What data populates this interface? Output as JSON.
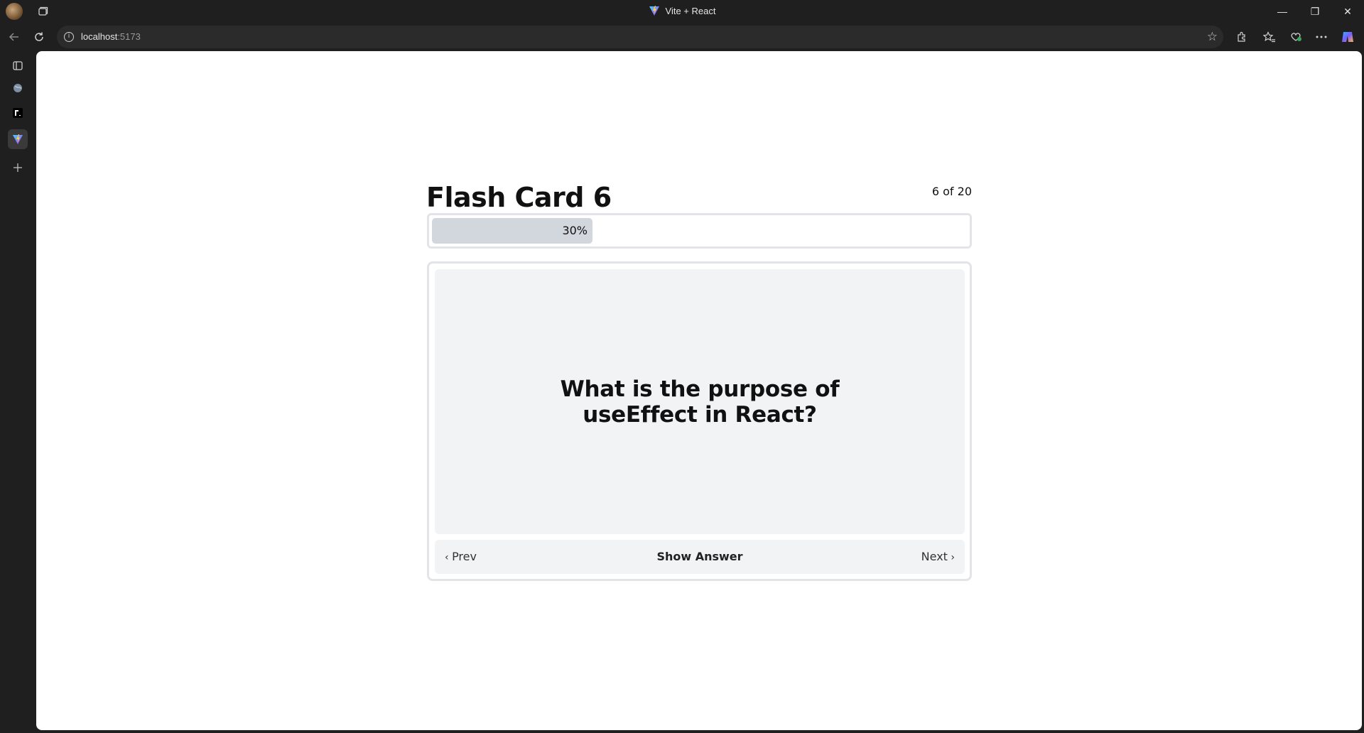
{
  "browser": {
    "window_title": "Vite + React",
    "url_host": "localhost",
    "url_port": ":5173",
    "icons": [
      "profile-avatar",
      "tab-actions-icon",
      "back-icon",
      "refresh-icon",
      "site-info-icon",
      "favorite-star-icon",
      "extensions-icon",
      "favorites-icon",
      "browser-essentials-icon",
      "more-icon",
      "copilot-icon"
    ],
    "window_controls": {
      "minimize": "—",
      "restore": "❐",
      "close": "✕"
    }
  },
  "sidebar": {
    "items": [
      "workspaces-icon",
      "tab-icon-globe",
      "tab-icon-r",
      "tab-icon-vite",
      "new-tab-icon"
    ],
    "active_index": 3
  },
  "app": {
    "title": "Flash Card 6",
    "counter": "6 of 20",
    "progress": {
      "percent": 30,
      "label": "30%"
    },
    "question": "What is the purpose of useEffect in React?",
    "controls": {
      "prev": "Prev",
      "show_answer": "Show Answer",
      "next": "Next"
    }
  },
  "colors": {
    "chrome": "#1f1f1f",
    "page_bg": "#ffffff",
    "panel_bg": "#f2f3f5",
    "progress_fill": "#d2d6dd",
    "border": "#e2e4e8"
  }
}
